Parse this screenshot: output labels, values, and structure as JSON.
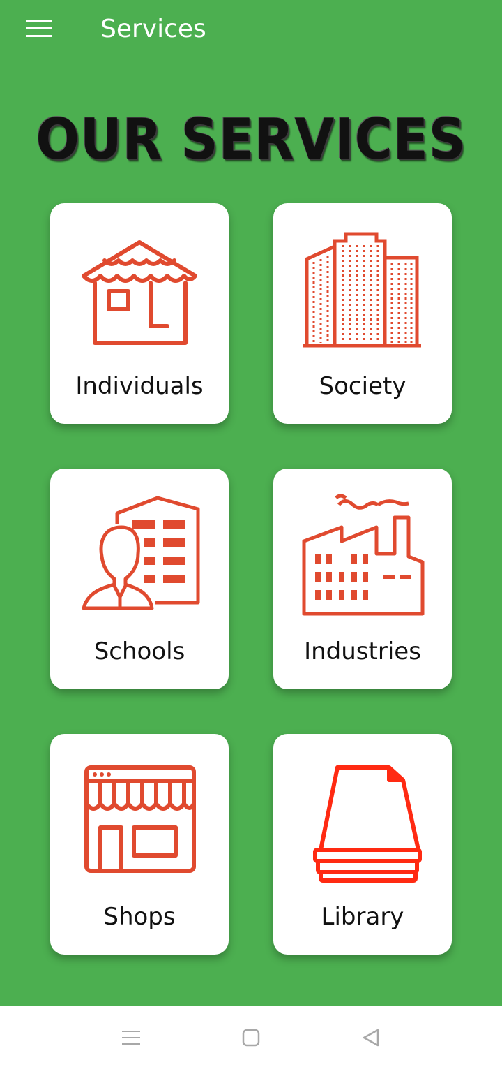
{
  "appbar": {
    "title": "Services",
    "menu_icon": "hamburger-menu-icon"
  },
  "banner": {
    "text": "OUR SERVICES"
  },
  "services": [
    {
      "label": "Individuals",
      "icon": "house-icon"
    },
    {
      "label": "Society",
      "icon": "buildings-icon"
    },
    {
      "label": "Schools",
      "icon": "person-building-icon"
    },
    {
      "label": "Industries",
      "icon": "factory-icon"
    },
    {
      "label": "Shops",
      "icon": "storefront-icon"
    },
    {
      "label": "Library",
      "icon": "document-stack-icon"
    }
  ],
  "navbar": {
    "recent_icon": "recent-apps-icon",
    "home_icon": "home-square-icon",
    "back_icon": "back-triangle-icon"
  },
  "colors": {
    "background": "#4caf50",
    "icon_red": "#e04a2f",
    "card": "#ffffff"
  }
}
